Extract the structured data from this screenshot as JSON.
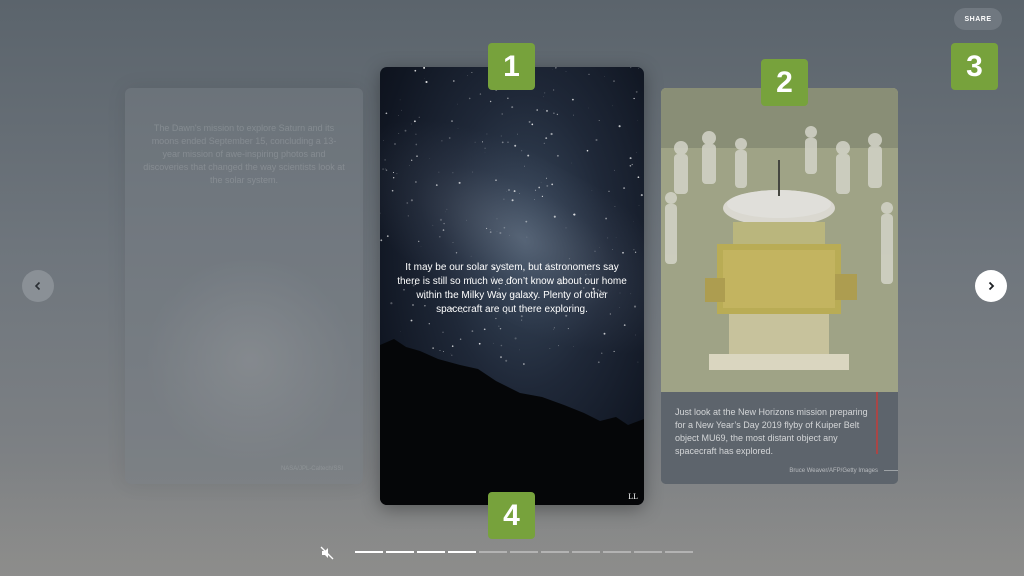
{
  "share": {
    "label": "SHARE"
  },
  "badges": {
    "b1": "1",
    "b2": "2",
    "b3": "3",
    "b4": "4"
  },
  "cards": {
    "left": {
      "caption": "The Dawn's mission to explore Saturn and its moons ended September 15, concluding a 13-year mission of awe-inspiring photos and discoveries that changed the way scientists look at the solar system.",
      "credit": "NASA/JPL-Caltech/SSI"
    },
    "main": {
      "caption": "It may be our solar system, but astronomers say there is still so much we don’t know about our home within the Milky Way galaxy. Plenty of other spacecraft are out there exploring.",
      "signature": "LL"
    },
    "right": {
      "caption": "Just look at the New Horizons mission preparing for a New Year’s Day 2019 flyby of Kuiper Belt object MU69, the most distant object any spacecraft has explored.",
      "credit": "Bruce Weaver/AFP/Getty Images"
    }
  },
  "progress": {
    "total": 11,
    "completed": 4
  },
  "icons": {
    "prev": "chevron-left-icon",
    "next": "chevron-right-icon",
    "mute": "speaker-muted-icon"
  },
  "colors": {
    "badge": "#77a23c",
    "accent_red": "#a94646"
  }
}
